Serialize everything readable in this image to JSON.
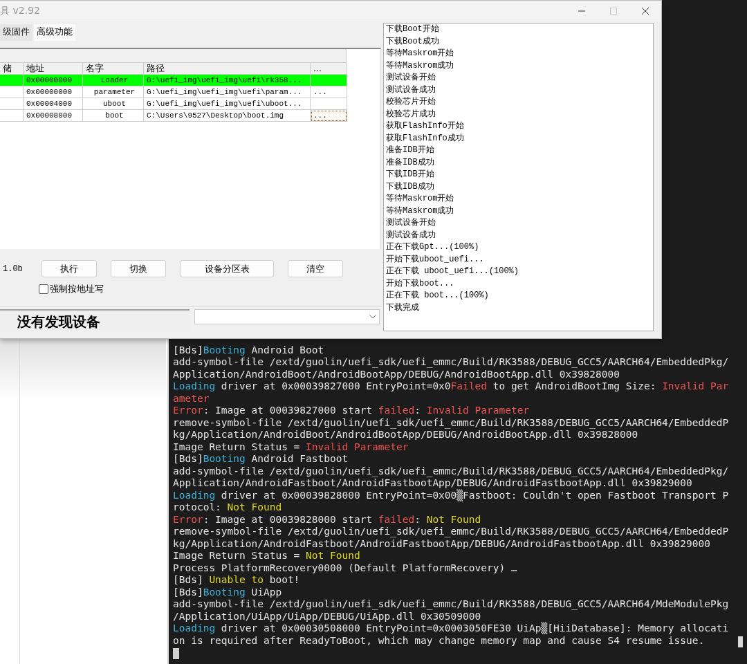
{
  "terminal": {
    "lines": [
      [
        {
          "text": "[Bds]",
          "kind": "plain"
        },
        {
          "text": "Booting",
          "kind": "info"
        },
        {
          "text": " Android Boot",
          "kind": "plain"
        }
      ],
      [
        {
          "text": "add-symbol-file /extd/guolin/uefi_sdk/uefi_emmc/Build/RK3588/DEBUG_GCC5/AARCH64/EmbeddedPkg/",
          "kind": "plain"
        }
      ],
      [
        {
          "text": "Application/AndroidBoot/AndroidBootApp/DEBUG/AndroidBootApp.dll 0x39828000",
          "kind": "plain"
        }
      ],
      [
        {
          "text": "Loading",
          "kind": "info"
        },
        {
          "text": " driver at 0x00039827000 EntryPoint=0x0",
          "kind": "plain"
        },
        {
          "text": "Failed",
          "kind": "error"
        },
        {
          "text": " to get AndroidBootImg Size: ",
          "kind": "plain"
        },
        {
          "text": "Invalid Par",
          "kind": "error"
        }
      ],
      [
        {
          "text": "ameter",
          "kind": "error"
        }
      ],
      [
        {
          "text": "Error",
          "kind": "error"
        },
        {
          "text": ": Image at 00039827000 start ",
          "kind": "plain"
        },
        {
          "text": "failed",
          "kind": "error"
        },
        {
          "text": ": ",
          "kind": "plain"
        },
        {
          "text": "Invalid Parameter",
          "kind": "error"
        }
      ],
      [
        {
          "text": "remove-symbol-file /extd/guolin/uefi_sdk/uefi_emmc/Build/RK3588/DEBUG_GCC5/AARCH64/EmbeddedP",
          "kind": "plain"
        }
      ],
      [
        {
          "text": "kg/Application/AndroidBoot/AndroidBootApp/DEBUG/AndroidBootApp.dll 0x39828000",
          "kind": "plain"
        }
      ],
      [
        {
          "text": "Image Return Status = ",
          "kind": "plain"
        },
        {
          "text": "Invalid Parameter",
          "kind": "error"
        }
      ],
      [
        {
          "text": "[Bds]",
          "kind": "plain"
        },
        {
          "text": "Booting",
          "kind": "info"
        },
        {
          "text": " Android Fastboot",
          "kind": "plain"
        }
      ],
      [
        {
          "text": "add-symbol-file /extd/guolin/uefi_sdk/uefi_emmc/Build/RK3588/DEBUG_GCC5/AARCH64/EmbeddedPkg/",
          "kind": "plain"
        }
      ],
      [
        {
          "text": "Application/AndroidFastboot/AndroidFastbootApp/DEBUG/AndroidFastbootApp.dll 0x39829000",
          "kind": "plain"
        }
      ],
      [
        {
          "text": "Loading",
          "kind": "info"
        },
        {
          "text": " driver at 0x00039828000 EntryPoint=0x00▒Fastboot: Couldn't open Fastboot Transport P",
          "kind": "plain"
        }
      ],
      [
        {
          "text": "rotocol: ",
          "kind": "plain"
        },
        {
          "text": "Not Found",
          "kind": "warn"
        }
      ],
      [
        {
          "text": "Error",
          "kind": "error"
        },
        {
          "text": ": Image at 00039828000 start ",
          "kind": "plain"
        },
        {
          "text": "failed",
          "kind": "error"
        },
        {
          "text": ": ",
          "kind": "plain"
        },
        {
          "text": "Not Found",
          "kind": "warn"
        }
      ],
      [
        {
          "text": "remove-symbol-file /extd/guolin/uefi_sdk/uefi_emmc/Build/RK3588/DEBUG_GCC5/AARCH64/EmbeddedP",
          "kind": "plain"
        }
      ],
      [
        {
          "text": "kg/Application/AndroidFastboot/AndroidFastbootApp/DEBUG/AndroidFastbootApp.dll 0x39829000",
          "kind": "plain"
        }
      ],
      [
        {
          "text": "Image Return Status = ",
          "kind": "plain"
        },
        {
          "text": "Not Found",
          "kind": "warn"
        }
      ],
      [
        {
          "text": "Process PlatformRecovery0000 (Default PlatformRecovery) …",
          "kind": "plain"
        }
      ],
      [
        {
          "text": "[Bds] ",
          "kind": "plain"
        },
        {
          "text": "Unable to",
          "kind": "warn"
        },
        {
          "text": " boot!",
          "kind": "plain"
        }
      ],
      [
        {
          "text": "[Bds]",
          "kind": "plain"
        },
        {
          "text": "Booting",
          "kind": "info"
        },
        {
          "text": " UiApp",
          "kind": "plain"
        }
      ],
      [
        {
          "text": "add-symbol-file /extd/guolin/uefi_sdk/uefi_emmc/Build/RK3588/DEBUG_GCC5/AARCH64/MdeModulePkg",
          "kind": "plain"
        }
      ],
      [
        {
          "text": "/Application/UiApp/UiApp/DEBUG/UiApp.dll 0x30509000",
          "kind": "plain"
        }
      ],
      [
        {
          "text": "Loading",
          "kind": "info"
        },
        {
          "text": " driver at 0x00030508000 EntryPoint=0x0003050FE30 UiAp▒[HiiDatabase]: Memory allocati",
          "kind": "plain"
        }
      ],
      [
        {
          "text": "on is required after ReadyToBoot, which may change memory map and cause S4 resume issue.",
          "kind": "plain"
        }
      ]
    ]
  },
  "window": {
    "title": "具 v2.92",
    "tabs": [
      {
        "label": "级固件",
        "selected": false
      },
      {
        "label": "高级功能",
        "selected": true
      }
    ],
    "table": {
      "columns": [
        "储",
        "地址",
        "名字",
        "路径",
        "..."
      ],
      "rows": [
        {
          "address": "0x00000000",
          "name": "Loader",
          "path": "G:\\uefi_img\\uefi_img\\uefi\\rk358...",
          "selected": true
        },
        {
          "address": "0x00000000",
          "name": "parameter",
          "path": "G:\\uefi_img\\uefi_img\\uefi\\param...",
          "button": "...",
          "selected": false,
          "focused": false
        },
        {
          "address": "0x00004000",
          "name": "uboot",
          "path": "G:\\uefi_img\\uefi_img\\uefi\\uboot...",
          "selected": false
        },
        {
          "address": "0x00008000",
          "name": "boot",
          "path": "C:\\Users\\9527\\Desktop\\boot.img",
          "button": "...",
          "selected": false,
          "focused": true
        }
      ]
    },
    "version": "1.0b",
    "buttons": [
      "执行",
      "切换",
      "设备分区表",
      "清空"
    ],
    "checkbox": {
      "label": "强制按地址写",
      "checked": false
    },
    "status": "没有发现设备",
    "log": [
      "下载Boot开始",
      "下载Boot成功",
      "等待Maskrom开始",
      "等待Maskrom成功",
      "测试设备开始",
      "测试设备成功",
      "校验芯片开始",
      "校验芯片成功",
      "获取FlashInfo开始",
      "获取FlashInfo成功",
      "准备IDB开始",
      "准备IDB成功",
      "下载IDB开始",
      "下载IDB成功",
      "等待Maskrom开始",
      "等待Maskrom成功",
      "测试设备开始",
      "测试设备成功",
      "正在下载Gpt...(100%)",
      "开始下载uboot_uefi...",
      "正在下载 uboot_uefi...(100%)",
      "开始下载boot...",
      "正在下载 boot...(100%)",
      "下载完成"
    ]
  }
}
